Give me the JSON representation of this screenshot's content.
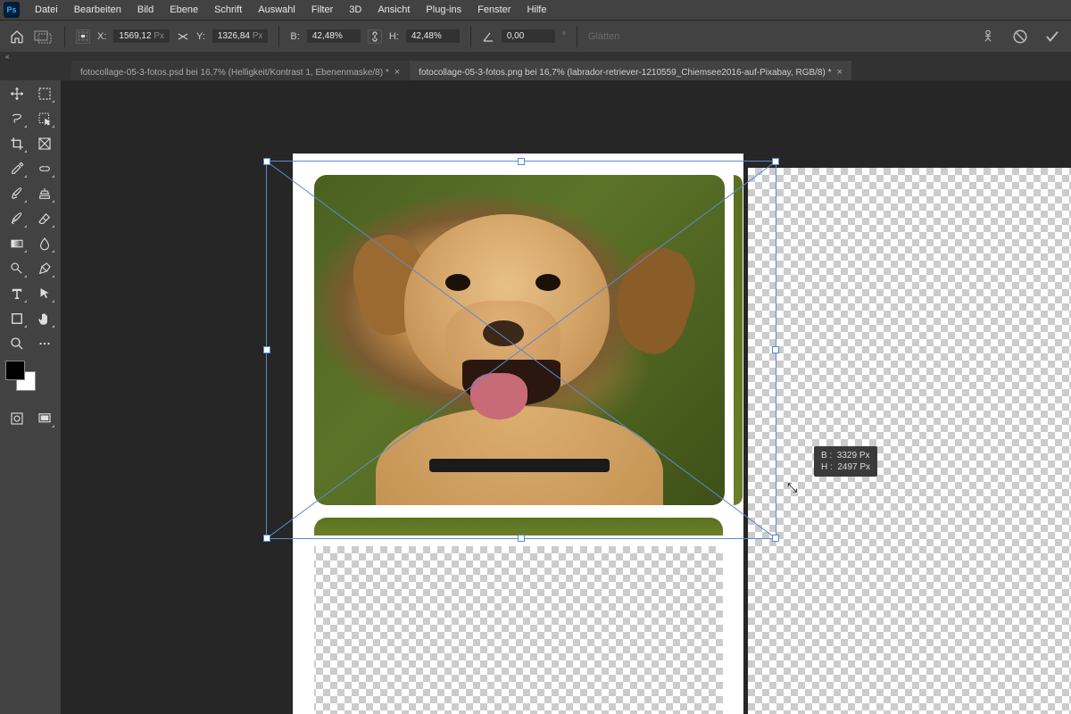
{
  "menu": {
    "items": [
      "Datei",
      "Bearbeiten",
      "Bild",
      "Ebene",
      "Schrift",
      "Auswahl",
      "Filter",
      "3D",
      "Ansicht",
      "Plug-ins",
      "Fenster",
      "Hilfe"
    ]
  },
  "options": {
    "x_label": "X:",
    "x_value": "1569,12",
    "x_unit": "Px",
    "y_label": "Y:",
    "y_value": "1326,84",
    "y_unit": "Px",
    "w_label": "B:",
    "w_value": "42,48%",
    "h_label": "H:",
    "h_value": "42,48%",
    "angle_label": "",
    "angle_value": "0,00",
    "angle_unit": "°",
    "smooth": "Glätten"
  },
  "tabs": [
    {
      "title": "fotocollage-05-3-fotos.psd bei 16,7% (Helligkeit/Kontrast 1, Ebenenmaske/8) *",
      "active": false
    },
    {
      "title": "fotocollage-05-3-fotos.png bei 16,7% (labrador-retriever-1210559_Chiemsee2016-auf-Pixabay, RGB/8) *",
      "active": true
    }
  ],
  "tooltip": {
    "w_label": "B :",
    "w_value": "3329 Px",
    "h_label": "H :",
    "h_value": "2497 Px"
  },
  "tools": [
    [
      "move-tool",
      "marquee-tool"
    ],
    [
      "lasso-tool",
      "object-select-tool"
    ],
    [
      "crop-tool",
      "frame-tool"
    ],
    [
      "eyedropper-tool",
      "healing-tool"
    ],
    [
      "brush-tool",
      "clone-stamp-tool"
    ],
    [
      "history-brush-tool",
      "eraser-tool"
    ],
    [
      "gradient-tool",
      "blur-tool"
    ],
    [
      "dodge-tool",
      "pen-tool"
    ],
    [
      "text-tool",
      "path-select-tool"
    ],
    [
      "shape-tool",
      "hand-tool"
    ],
    [
      "zoom-tool",
      "edit-toolbar"
    ]
  ]
}
